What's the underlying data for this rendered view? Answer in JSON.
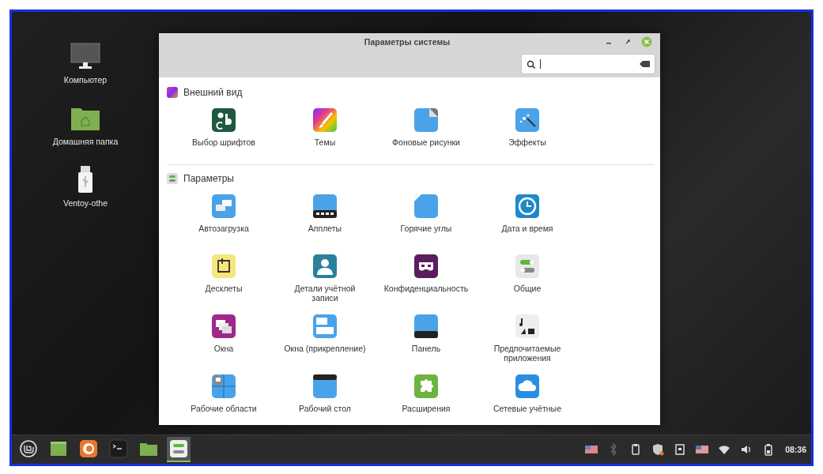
{
  "desktop_icons": [
    {
      "label": "Компьютер"
    },
    {
      "label": "Домашняя папка"
    },
    {
      "label": "Ventoy-othe"
    }
  ],
  "window": {
    "title": "Параметры системы"
  },
  "sections": [
    {
      "title": "Внешний вид",
      "items": [
        {
          "label": "Выбор шрифтов"
        },
        {
          "label": "Темы"
        },
        {
          "label": "Фоновые рисунки"
        },
        {
          "label": "Эффекты"
        }
      ]
    },
    {
      "title": "Параметры",
      "items": [
        {
          "label": "Автозагрузка"
        },
        {
          "label": "Апплеты"
        },
        {
          "label": "Горячие углы"
        },
        {
          "label": "Дата и время"
        },
        {
          "label": "Десклеты"
        },
        {
          "label": "Детали учётной записи"
        },
        {
          "label": "Конфиденциальность"
        },
        {
          "label": "Общие"
        },
        {
          "label": "Окна"
        },
        {
          "label": "Окна (прикрепление)"
        },
        {
          "label": "Панель"
        },
        {
          "label": "Предпочитаемые приложения"
        },
        {
          "label": "Рабочие области"
        },
        {
          "label": "Рабочий стол"
        },
        {
          "label": "Расширения"
        },
        {
          "label": "Сетевые учётные"
        }
      ]
    }
  ],
  "taskbar": {
    "launchers": [
      {
        "active": false
      },
      {
        "active": false
      },
      {
        "active": false
      },
      {
        "active": false
      },
      {
        "active": true
      }
    ],
    "clock": "08:36"
  }
}
